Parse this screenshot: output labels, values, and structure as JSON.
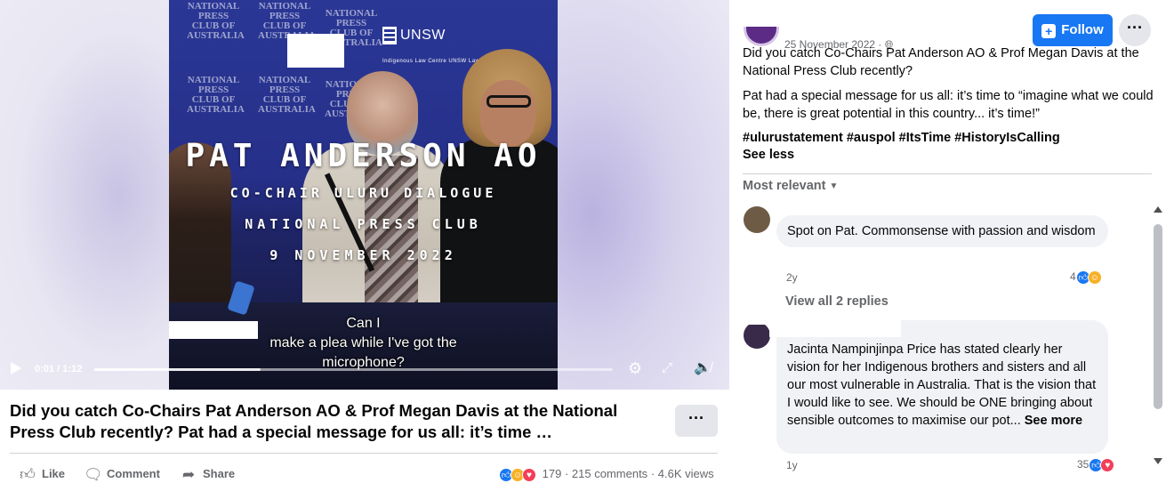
{
  "video": {
    "overlay": {
      "title": "PAT ANDERSON AO",
      "line2": "CO-CHAIR ULURU DIALOGUE",
      "line3": "NATIONAL PRESS CLUB",
      "line4": "9 NOVEMBER 2022"
    },
    "background_tile": "NATIONAL PRESS CLUB OF AUSTRALIA",
    "logo": {
      "name": "UNSW",
      "sub": "Indigenous Law Centre UNSW Law"
    },
    "caption": [
      "Can I",
      "make a plea while I've got the",
      "microphone?"
    ],
    "controls": {
      "time": "0:01 / 1:12",
      "progress": 0.014,
      "buffer": 0.32,
      "icons": [
        "play-icon",
        "settings-icon",
        "fullscreen-icon",
        "mute-icon"
      ]
    }
  },
  "post": {
    "text": "Did you catch Co-Chairs Pat Anderson AO & Prof Megan Davis at the National Press Club recently? Pat had a special message for us all: it’s time …",
    "more_label": "···",
    "actions": {
      "like": "Like",
      "comment": "Comment",
      "share": "Share"
    },
    "stats": {
      "reactions": "179",
      "comments": "215 comments",
      "views": "4.6K views",
      "separator": "·"
    }
  },
  "sidebar": {
    "date": "25 November 2022 · ",
    "follow_label": "Follow",
    "more_label": "···",
    "paragraph1": "Did you catch Co-Chairs Pat Anderson AO & Prof Megan Davis at the National Press Club recently?",
    "paragraph2": "Pat had a special message for us all: it’s time to “imagine what we could be, there is great potential in this country... it’s time!”",
    "hashtags": "#ulurustatement #auspol #ItsTime #HistoryIsCalling",
    "see_less": "See less",
    "sort_label": "Most relevant",
    "comments": [
      {
        "text": "Spot on Pat. Commonsense with passion and wisdom",
        "age": "2y",
        "reactions": "4"
      },
      {
        "text": "Jacinta Nampinjinpa Price has stated clearly her vision for her Indigenous brothers and sisters and all our most vulnerable in Australia. That is the vision that I would like to see. We should be ONE bringing about sensible outcomes to maximise our pot...",
        "see_more": "See more",
        "age": "1y",
        "reactions": "35"
      }
    ],
    "view_replies": "View all 2 replies"
  },
  "colors": {
    "accent": "#1877f2",
    "muted": "#65676b",
    "bubble": "#f0f2f5"
  }
}
